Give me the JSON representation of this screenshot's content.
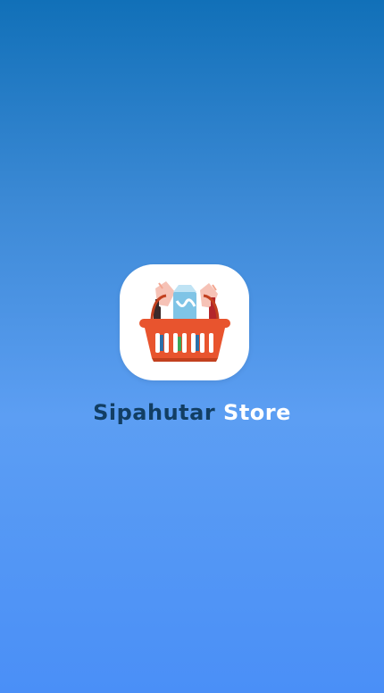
{
  "app": {
    "name_part1": "Sipahutar",
    "name_part2": "Store",
    "logo_icon": "grocery-basket-icon"
  },
  "colors": {
    "gradient_top": "#1170b8",
    "gradient_bottom": "#4a8ff7",
    "name_part1_color": "#123e63",
    "name_part2_color": "#ffffff",
    "basket": "#e8542e"
  }
}
